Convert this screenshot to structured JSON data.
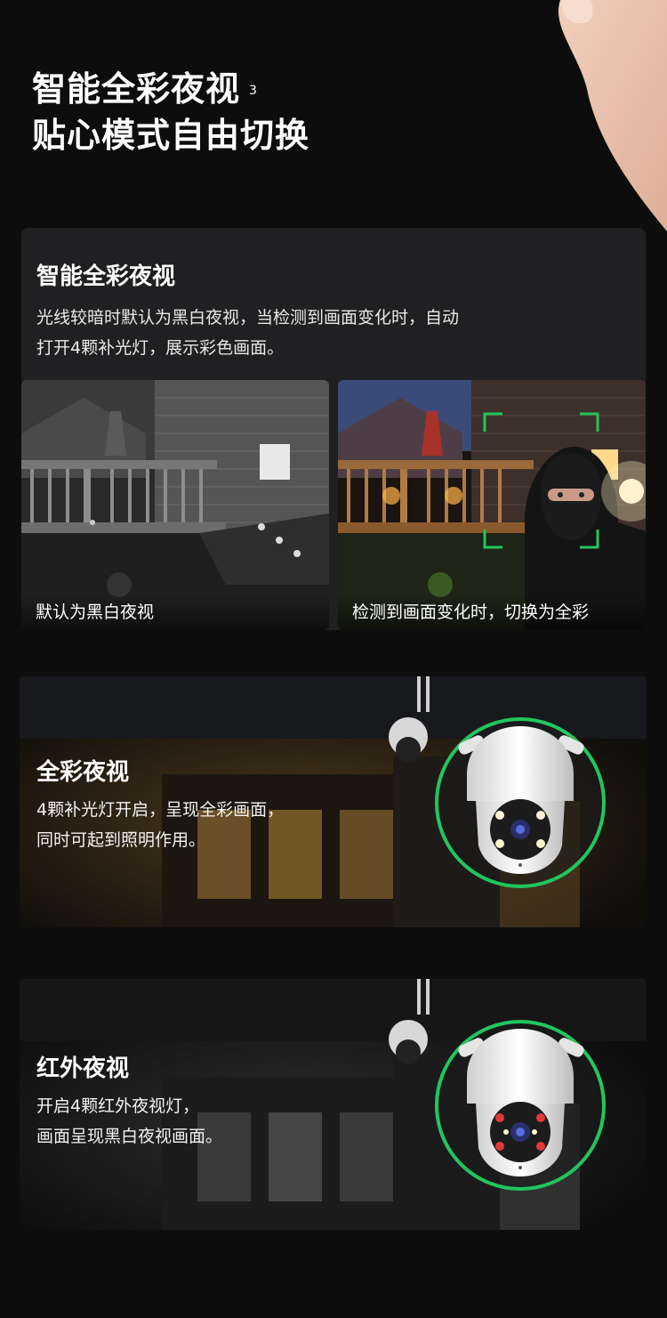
{
  "hero": {
    "line1": "智能全彩夜视",
    "sup": "3",
    "line2": "贴心模式自由切换"
  },
  "smart_card": {
    "title": "智能全彩夜视",
    "desc_line1": "光线较暗时默认为黑白夜视，当检测到画面变化时，自动",
    "desc_line2": "打开4颗补光灯，展示彩色画面。",
    "left_caption": "默认为黑白夜视",
    "right_caption": "检测到画面变化时，切换为全彩"
  },
  "color_mode": {
    "title": "全彩夜视",
    "desc_line1": "4颗补光灯开启，呈现全彩画面，",
    "desc_line2": "同时可起到照明作用。"
  },
  "ir_mode": {
    "title": "红外夜视",
    "desc_line1": "开启4颗红外夜视灯，",
    "desc_line2": "画面呈现黑白夜视画面。"
  },
  "colors": {
    "accent_green": "#22c55e",
    "page_bg": "#0d0d0d",
    "card_bg": "#202022"
  }
}
